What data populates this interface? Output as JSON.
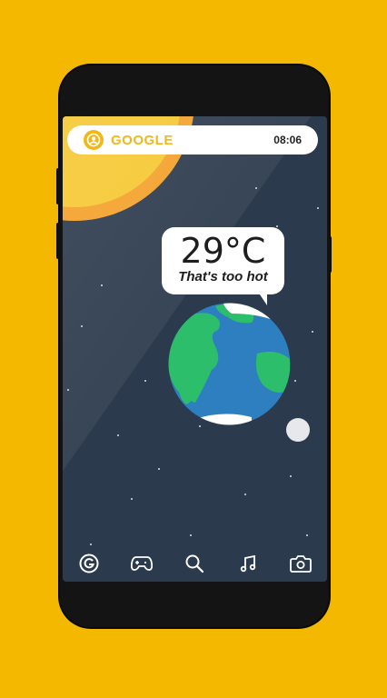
{
  "status": {
    "brand": "GOOGLE",
    "time": "08:06"
  },
  "weather": {
    "temperature": "29°C",
    "remark": "That's too hot"
  },
  "dock": {
    "icons": [
      "google-icon",
      "gamepad-icon",
      "search-icon",
      "music-icon",
      "camera-icon"
    ]
  },
  "colors": {
    "background": "#F5B800",
    "sky": "#2B3A4C",
    "sun": "#F5C832",
    "accent": "#F2B81A"
  }
}
